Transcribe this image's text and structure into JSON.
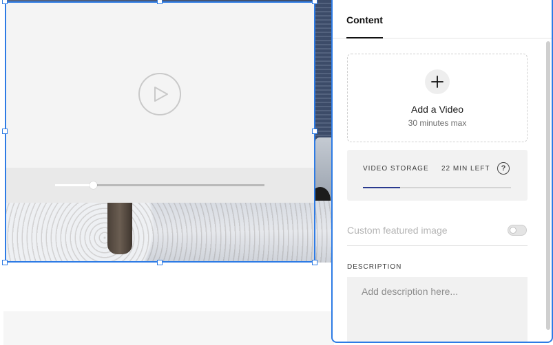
{
  "panel": {
    "tab_label": "Content",
    "add_video": {
      "title": "Add a Video",
      "subtitle": "30 minutes max",
      "icon": "plus-icon"
    },
    "storage": {
      "label": "VIDEO STORAGE",
      "remaining": "22 MIN LEFT",
      "help_glyph": "?",
      "used_fraction": 0.25
    },
    "featured_image": {
      "label": "Custom featured image",
      "enabled": false
    },
    "description": {
      "label": "DESCRIPTION",
      "placeholder": "Add description here..."
    }
  },
  "player": {
    "progress_fraction": 0.18,
    "play_icon": "play-icon"
  },
  "colors": {
    "selection": "#2d7be5",
    "storage_fill": "#2a3a8f"
  }
}
